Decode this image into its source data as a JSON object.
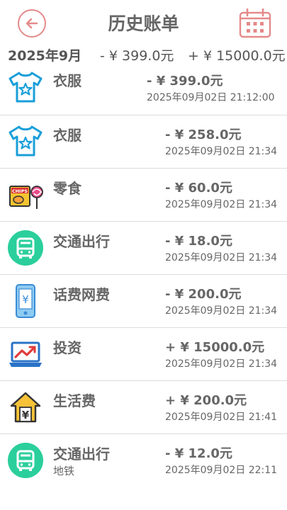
{
  "header": {
    "title": "历史账单",
    "back_icon": "back-arrow-icon",
    "calendar_icon": "calendar-icon",
    "accent_color": "#e58a8a"
  },
  "summary": {
    "month": "2025年9月",
    "expense": "- ¥ 399.0元",
    "income": "+ ¥ 15000.0元"
  },
  "records": [
    {
      "category": "衣服",
      "amount": "- ¥ 399.0元",
      "time": "2025年09月02日  21:12:00",
      "note": "",
      "icon": "tshirt-icon"
    },
    {
      "category": "衣服",
      "amount": "- ¥ 258.0元",
      "time": "2025年09月02日 21:34",
      "note": "",
      "icon": "tshirt-icon"
    },
    {
      "category": "零食",
      "amount": "- ¥ 60.0元",
      "time": "2025年09月02日 21:34",
      "note": "",
      "icon": "snacks-icon"
    },
    {
      "category": "交通出行",
      "amount": "- ¥ 18.0元",
      "time": "2025年09月02日 21:34",
      "note": "",
      "icon": "bus-icon"
    },
    {
      "category": "话费网费",
      "amount": "- ¥ 200.0元",
      "time": "2025年09月02日 21:34",
      "note": "",
      "icon": "phone-icon"
    },
    {
      "category": "投资",
      "amount": "+ ¥ 15000.0元",
      "time": "2025年09月02日 21:34",
      "note": "",
      "icon": "investment-icon"
    },
    {
      "category": "生活费",
      "amount": "+ ¥ 200.0元",
      "time": "2025年09月02日 21:41",
      "note": "",
      "icon": "living-expense-icon"
    },
    {
      "category": "交通出行",
      "amount": "- ¥ 12.0元",
      "time": "2025年09月02日 22:11",
      "note": "地铁",
      "icon": "bus-icon"
    }
  ]
}
